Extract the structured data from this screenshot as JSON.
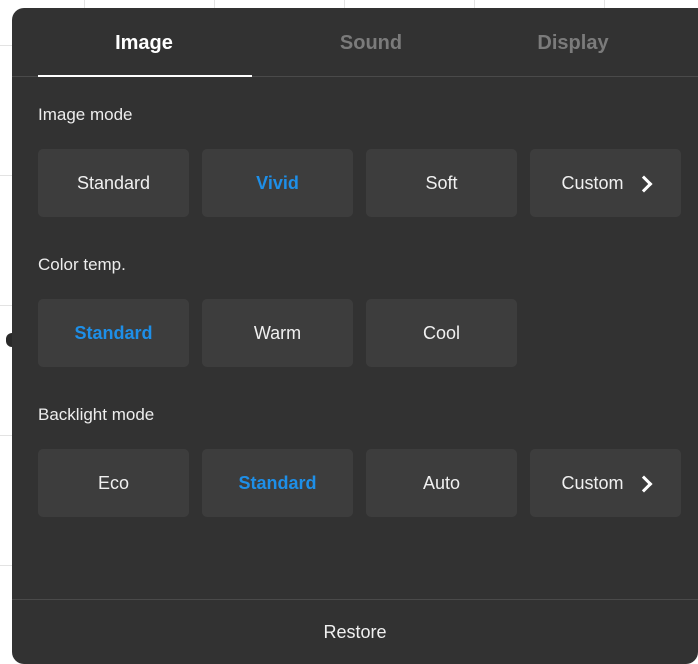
{
  "tabs": [
    {
      "label": "Image",
      "active": true
    },
    {
      "label": "Sound",
      "active": false
    },
    {
      "label": "Display",
      "active": false
    }
  ],
  "sections": {
    "image_mode": {
      "label": "Image mode",
      "options": [
        "Standard",
        "Vivid",
        "Soft",
        "Custom"
      ],
      "selected": "Vivid"
    },
    "color_temp": {
      "label": "Color temp.",
      "options": [
        "Standard",
        "Warm",
        "Cool"
      ],
      "selected": "Standard"
    },
    "backlight_mode": {
      "label": "Backlight mode",
      "options": [
        "Eco",
        "Standard",
        "Auto",
        "Custom"
      ],
      "selected": "Standard"
    }
  },
  "footer": {
    "restore_label": "Restore"
  },
  "colors": {
    "panel_bg": "#323232",
    "option_bg": "#3d3d3d",
    "accent": "#1e8fe8",
    "inactive_tab": "#7b7b7b"
  },
  "icons": {
    "custom_more": "chevron-right-icon"
  }
}
